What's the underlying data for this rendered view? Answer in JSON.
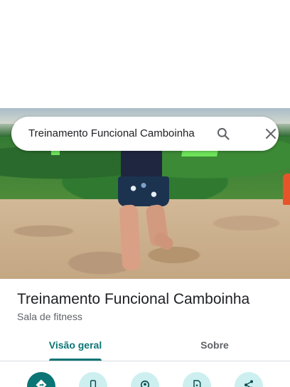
{
  "search": {
    "query": "Treinamento Funcional Camboinha",
    "search_icon": "search-icon",
    "close_icon": "close-icon"
  },
  "place": {
    "name": "Treinamento Funcional Camboinha",
    "category": "Sala de fitness"
  },
  "tabs": [
    {
      "label": "Visão geral",
      "active": true
    },
    {
      "label": "Sobre",
      "active": false
    }
  ],
  "actions": [
    {
      "icon": "directions-icon",
      "style": "filled"
    },
    {
      "icon": "phone-icon",
      "style": "tonal"
    },
    {
      "icon": "location-icon",
      "style": "tonal"
    },
    {
      "icon": "save-icon",
      "style": "tonal"
    },
    {
      "icon": "share-icon",
      "style": "tonal"
    }
  ],
  "colors": {
    "accent": "#0b7475",
    "accent_tonal": "#cdeff0",
    "text_primary": "#202124",
    "text_secondary": "#5f6368"
  }
}
